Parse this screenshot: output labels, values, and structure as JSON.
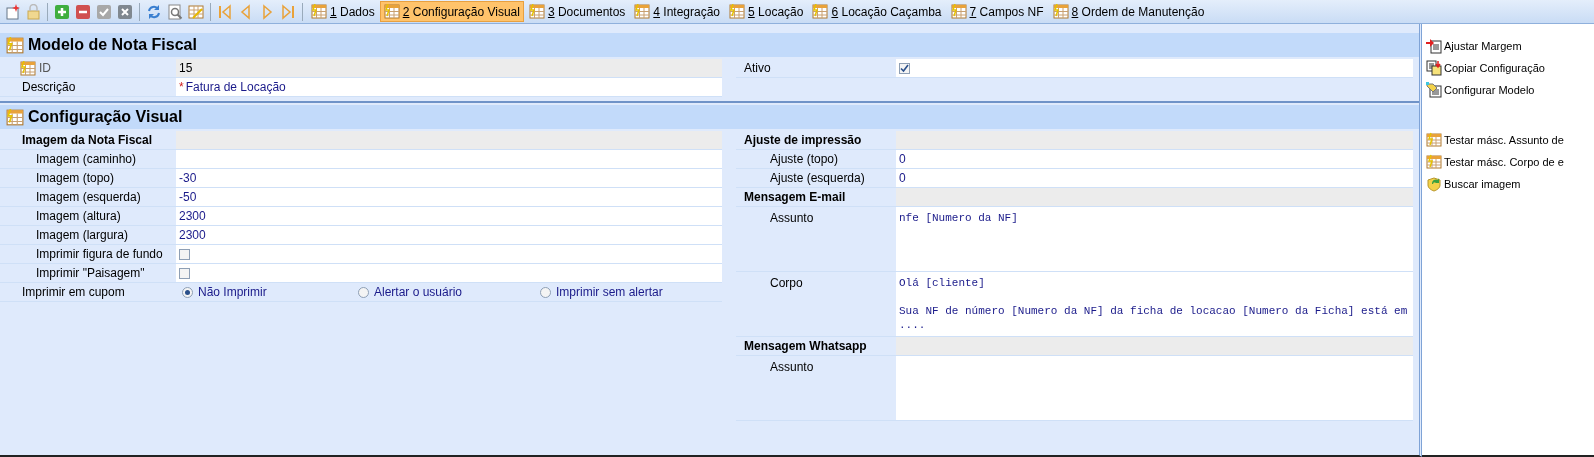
{
  "toolbar": {
    "tabs": [
      {
        "key": "1",
        "label": "Dados",
        "selected": false
      },
      {
        "key": "2",
        "label": "Configuração Visual",
        "selected": true
      },
      {
        "key": "3",
        "label": "Documentos",
        "selected": false
      },
      {
        "key": "4",
        "label": "Integração",
        "selected": false
      },
      {
        "key": "5",
        "label": "Locação",
        "selected": false
      },
      {
        "key": "6",
        "label": "Locação Caçamba",
        "selected": false
      },
      {
        "key": "7",
        "label": "Campos NF",
        "selected": false
      },
      {
        "key": "8",
        "label": "Ordem de Manutenção",
        "selected": false
      }
    ]
  },
  "model_section": {
    "title": "Modelo de Nota Fiscal",
    "left": [
      {
        "kind": "readonly",
        "label": "ID",
        "value": "15"
      },
      {
        "kind": "text",
        "label": "Descrição",
        "required_mark": "*",
        "value": "Fatura de Locação"
      }
    ],
    "right": [
      {
        "kind": "checkbox",
        "label": "Ativo",
        "checked": true
      }
    ]
  },
  "visual_section": {
    "title": "Configuração Visual",
    "left": [
      {
        "kind": "group",
        "label": "Imagem da Nota Fiscal",
        "children": [
          {
            "kind": "text",
            "label": "Imagem (caminho)"
          },
          {
            "kind": "text",
            "label": "Imagem (topo)",
            "value": "-30"
          },
          {
            "kind": "text",
            "label": "Imagem (esquerda)",
            "value": "-50"
          },
          {
            "kind": "text",
            "label": "Imagem (altura)",
            "value": "2300"
          },
          {
            "kind": "text",
            "label": "Imagem (largura)",
            "value": "2300"
          },
          {
            "kind": "checkbox",
            "label": "Imprimir figura de fundo",
            "checked": false
          },
          {
            "kind": "checkbox",
            "label": "Imprimir \"Paisagem\"",
            "checked": false
          }
        ]
      },
      {
        "kind": "radio",
        "label": "Imprimir em cupom",
        "options": [
          {
            "label": "Não Imprimir",
            "selected": true
          },
          {
            "label": "Alertar o usuário",
            "selected": false
          },
          {
            "label": "Imprimir sem alertar",
            "selected": false
          }
        ]
      }
    ],
    "right": [
      {
        "kind": "group",
        "label": "Ajuste de impressão",
        "children": [
          {
            "kind": "text",
            "label": "Ajuste (topo)",
            "value": "0"
          },
          {
            "kind": "text",
            "label": "Ajuste (esquerda)",
            "value": "0"
          }
        ]
      },
      {
        "kind": "group",
        "label": "Mensagem E-mail",
        "children": [
          {
            "kind": "memo",
            "label": "Assunto",
            "value": "nfe [Numero da NF]"
          },
          {
            "kind": "memo",
            "label": "Corpo",
            "value": "Olá [cliente]\n\nSua NF de número [Numero da NF] da ficha de locacao [Numero da Ficha] está em\n...."
          }
        ]
      },
      {
        "kind": "group",
        "label": "Mensagem Whatsapp",
        "children": [
          {
            "kind": "memo",
            "label": "Assunto"
          }
        ]
      }
    ]
  },
  "side_panel": {
    "groups": [
      [
        {
          "label": "Ajustar Margem"
        },
        {
          "label": "Copiar Configuração"
        },
        {
          "label": "Configurar Modelo"
        }
      ],
      [
        {
          "label": "Testar másc. Assunto de"
        },
        {
          "label": "Testar másc. Corpo de e"
        },
        {
          "label": "Buscar imagem"
        }
      ]
    ]
  }
}
